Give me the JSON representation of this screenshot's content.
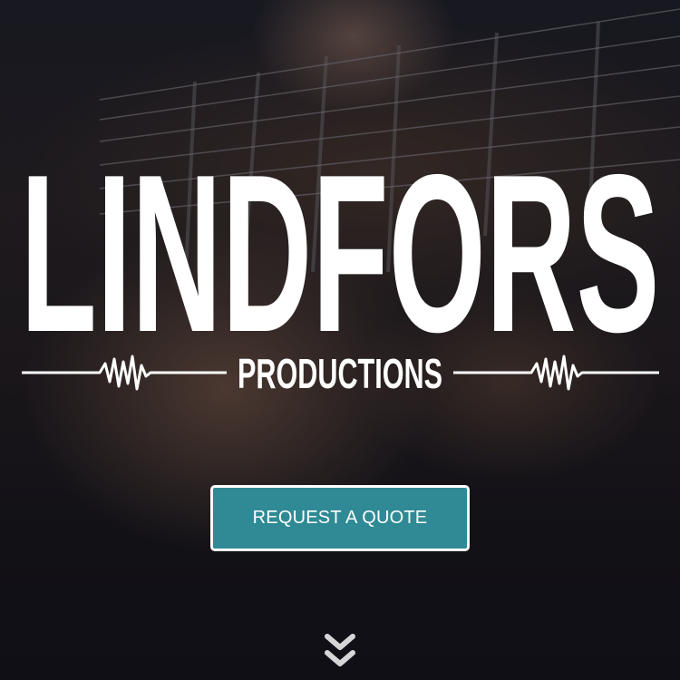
{
  "brand": {
    "wordmark": "LINDFORS",
    "tagline": "PRODUCTIONS"
  },
  "cta": {
    "label": "REQUEST A QUOTE",
    "color": "#2f8a95"
  },
  "icons": {
    "scroll": "double-chevron-down-icon",
    "waveform": "waveform-icon"
  }
}
